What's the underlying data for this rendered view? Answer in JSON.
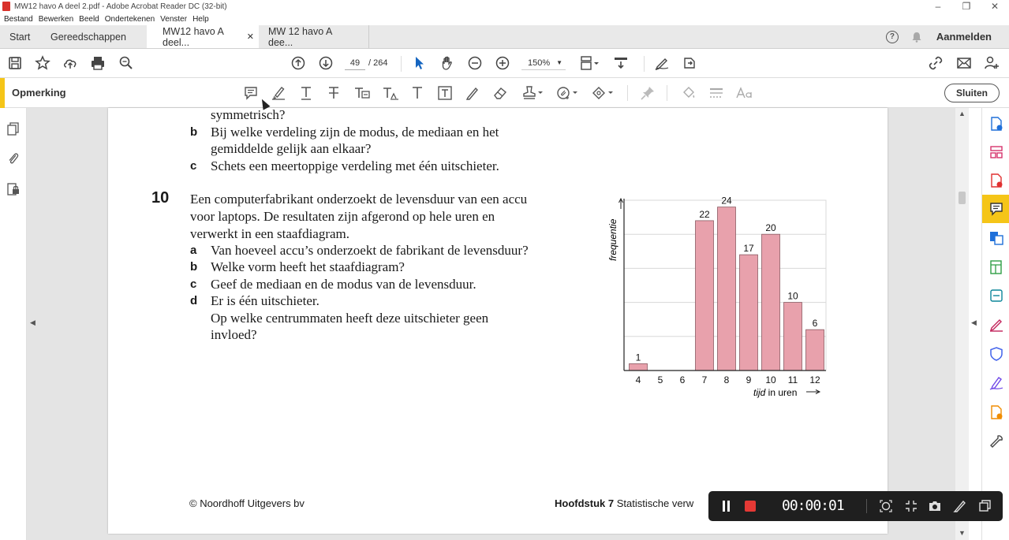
{
  "window": {
    "title": "MW12 havo A deel 2.pdf - Adobe Acrobat Reader DC (32-bit)",
    "controls": [
      "–",
      "❐",
      "✕"
    ]
  },
  "menu": [
    "Bestand",
    "Bewerken",
    "Beeld",
    "Ondertekenen",
    "Venster",
    "Help"
  ],
  "tabs": {
    "start": "Start",
    "tools": "Gereedschappen",
    "doc1": "MW12 havo A deel...",
    "doc2": "MW 12 havo A dee...",
    "close": "✕",
    "help": "?",
    "signin": "Aanmelden"
  },
  "toolbar": {
    "page_current": "49",
    "page_total": "/ 264",
    "zoom": "150%"
  },
  "commentbar": {
    "label": "Opmerking",
    "close_label": "Sluiten"
  },
  "document": {
    "prev_line": "symmetrisch?",
    "prev_items": [
      {
        "letter": "b",
        "lines": [
          "Bij welke verdeling zijn de modus, de mediaan en het",
          "gemiddelde gelijk aan elkaar?"
        ]
      },
      {
        "letter": "c",
        "lines": [
          "Schets een meertoppige verdeling met één uitschieter."
        ]
      }
    ],
    "question_number": "10",
    "question_intro": [
      "Een computerfabrikant onderzoekt de levensduur van een accu",
      "voor laptops. De resultaten zijn afgerond op hele uren en",
      "verwerkt in een staafdiagram."
    ],
    "items": [
      {
        "letter": "a",
        "lines": [
          "Van hoeveel accu’s onderzoekt de fabrikant de levensduur?"
        ]
      },
      {
        "letter": "b",
        "lines": [
          "Welke vorm heeft het staafdiagram?"
        ]
      },
      {
        "letter": "c",
        "lines": [
          "Geef de mediaan en de modus van de levensduur."
        ]
      },
      {
        "letter": "d",
        "lines": [
          "Er is één uitschieter.",
          "Op welke centrummaten heeft deze uitschieter geen",
          "invloed?"
        ]
      }
    ],
    "footer_left": "© Noordhoff Uitgevers bv",
    "footer_right_bold": "Hoofdstuk 7",
    "footer_right": " Statistische verw"
  },
  "chart_data": {
    "type": "bar",
    "categories": [
      "4",
      "5",
      "6",
      "7",
      "8",
      "9",
      "10",
      "11",
      "12"
    ],
    "values": [
      1,
      0,
      0,
      22,
      24,
      17,
      20,
      10,
      6
    ],
    "data_labels": [
      "1",
      "",
      "",
      "22",
      "24",
      "17",
      "20",
      "10",
      "6"
    ],
    "ylabel": "frequentie",
    "xlabel_italic": "tijd",
    "xlabel_rest": " in uren",
    "ylim": [
      0,
      25
    ],
    "grid": true,
    "bar_color": "#e8a1ac"
  },
  "recorder": {
    "time": "00:00:01"
  },
  "colors": {
    "accent": "#f5c518",
    "record": "#e53935"
  }
}
